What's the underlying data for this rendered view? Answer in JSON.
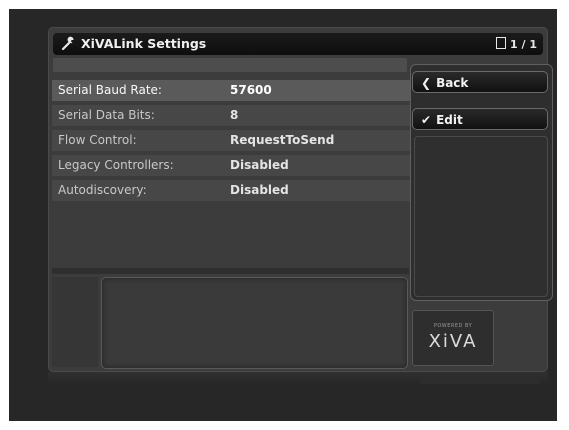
{
  "header": {
    "title": "XiVALink Settings",
    "page_indicator": "1 / 1"
  },
  "settings": [
    {
      "label": "Serial Baud Rate:",
      "value": "57600",
      "selected": true
    },
    {
      "label": "Serial Data Bits:",
      "value": "8",
      "selected": false
    },
    {
      "label": "Flow Control:",
      "value": "RequestToSend",
      "selected": false
    },
    {
      "label": "Legacy Controllers:",
      "value": "Disabled",
      "selected": false
    },
    {
      "label": "Autodiscovery:",
      "value": "Disabled",
      "selected": false
    }
  ],
  "sidebar": {
    "back_label": "Back",
    "edit_label": "Edit"
  },
  "logo": {
    "powered_by": "POWERED BY",
    "brand": "XiVA"
  },
  "icons": {
    "title": "wrench-icon",
    "page": "page-icon",
    "back": "chevron-left-icon",
    "edit": "checkmark-icon"
  }
}
